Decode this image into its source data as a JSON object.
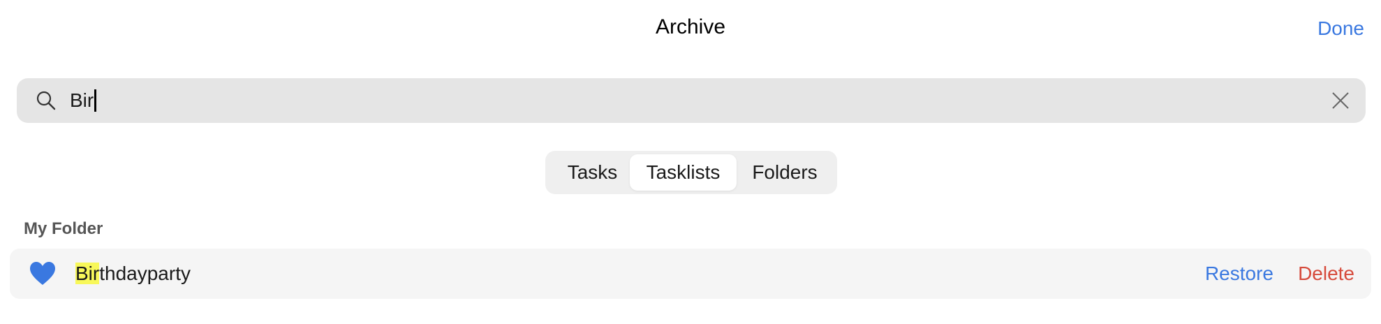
{
  "header": {
    "title": "Archive",
    "done_label": "Done"
  },
  "search": {
    "value": "Bir",
    "clear_icon": "close-icon",
    "search_icon": "search-icon"
  },
  "segmented": {
    "options": [
      "Tasks",
      "Tasklists",
      "Folders"
    ],
    "selected": "Tasklists"
  },
  "sections": [
    {
      "header": "My Folder",
      "items": [
        {
          "icon": "heart-icon",
          "icon_color": "#3a78e0",
          "title_match": "Bir",
          "title_rest": "thdayparty",
          "restore_label": "Restore",
          "delete_label": "Delete"
        }
      ]
    }
  ],
  "colors": {
    "accent": "#3a78e0",
    "destructive": "#d64a3b",
    "highlight": "#f8f85a"
  }
}
